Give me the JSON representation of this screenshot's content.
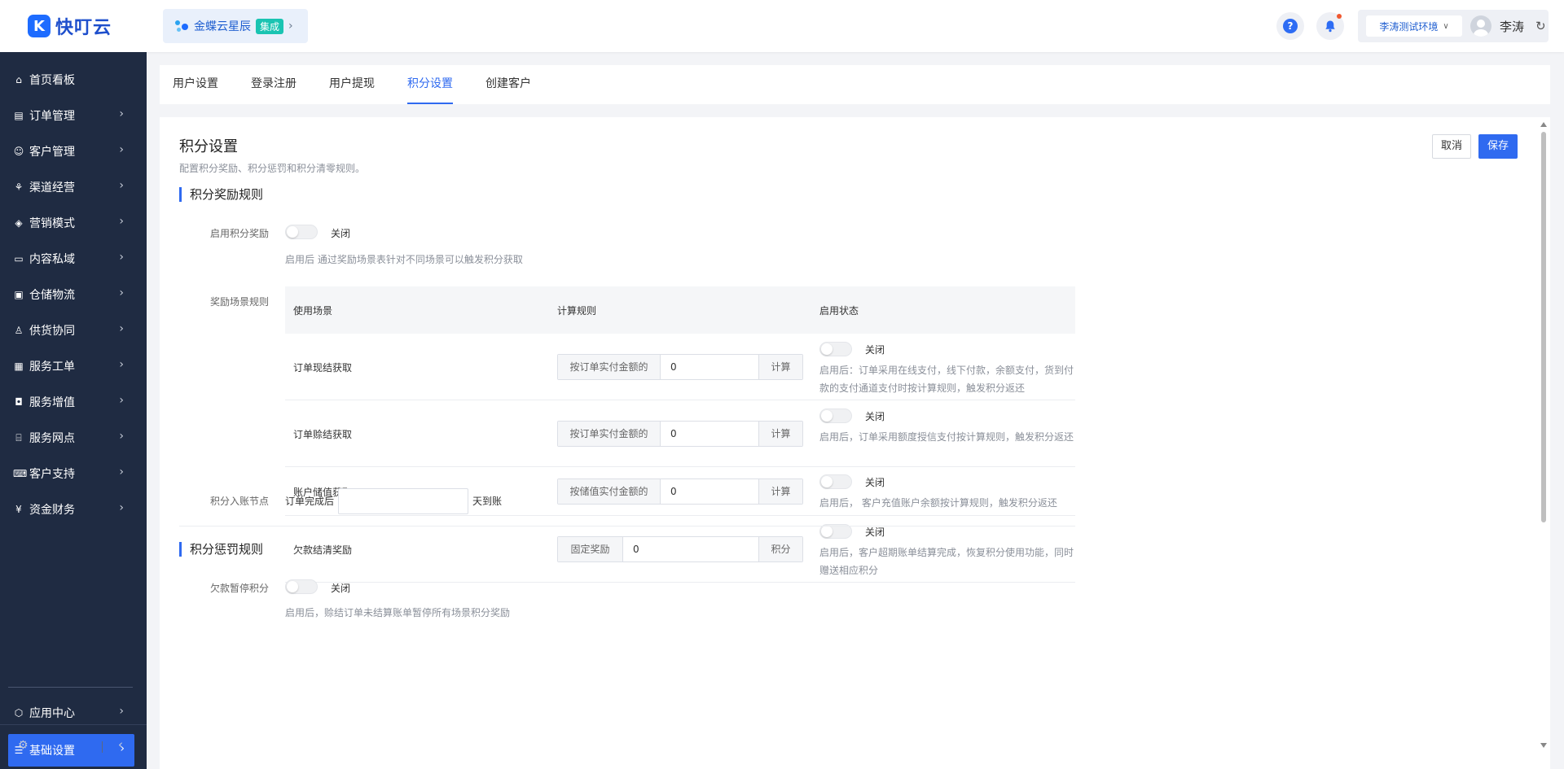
{
  "header": {
    "logo_mark": "K",
    "logo_text": "快叮云",
    "integration_label": "金蝶云星辰",
    "integration_badge": "集成",
    "help_icon": "?",
    "environment": "李涛测试环境",
    "user_name": "李涛"
  },
  "sidebar": {
    "items": [
      {
        "label": "首页看板",
        "icon": "home-icon"
      },
      {
        "label": "订单管理",
        "icon": "clipboard-icon"
      },
      {
        "label": "客户管理",
        "icon": "user-icon"
      },
      {
        "label": "渠道经营",
        "icon": "channel-icon"
      },
      {
        "label": "营销模式",
        "icon": "tag-icon"
      },
      {
        "label": "内容私域",
        "icon": "image-icon"
      },
      {
        "label": "仓储物流",
        "icon": "box-icon"
      },
      {
        "label": "供货协同",
        "icon": "handshake-icon"
      },
      {
        "label": "服务工单",
        "icon": "ticket-icon"
      },
      {
        "label": "服务增值",
        "icon": "bag-icon"
      },
      {
        "label": "服务网点",
        "icon": "store-icon"
      },
      {
        "label": "客户支持",
        "icon": "support-icon"
      },
      {
        "label": "资金财务",
        "icon": "yuan-icon"
      }
    ],
    "bottom_items": [
      {
        "label": "应用中心",
        "icon": "cube-icon"
      },
      {
        "label": "基础设置",
        "icon": "settings-sliders-icon"
      }
    ]
  },
  "tabs": [
    "用户设置",
    "登录注册",
    "用户提现",
    "积分设置",
    "创建客户"
  ],
  "active_tab": "积分设置",
  "page": {
    "title": "积分设置",
    "description": "配置积分奖励、积分惩罚和积分清零规则。",
    "cancel_label": "取消",
    "save_label": "保存"
  },
  "reward": {
    "section_title": "积分奖励规则",
    "enable_label": "启用积分奖励",
    "enable_state": "关闭",
    "enable_hint": "启用后 通过奖励场景表针对不同场景可以触发积分获取",
    "scene_label": "奖励场景规则",
    "columns": [
      "使用场景",
      "计算规则",
      "启用状态"
    ],
    "rows": [
      {
        "scene": "订单现结获取",
        "prefix": "按订单实付金额的",
        "value": "0",
        "suffix": "计算",
        "state": "关闭",
        "desc": "启用后：订单采用在线支付，线下付款，余额支付，货到付款的支付通道支付时按计算规则，触发积分返还"
      },
      {
        "scene": "订单赊结获取",
        "prefix": "按订单实付金额的",
        "value": "0",
        "suffix": "计算",
        "state": "关闭",
        "desc": "启用后，订单采用额度授信支付按计算规则，触发积分返还"
      },
      {
        "scene": "账户储值获取",
        "prefix": "按储值实付金额的",
        "value": "0",
        "suffix": "计算",
        "state": "关闭",
        "desc": "启用后， 客户充值账户余额按计算规则，触发积分返还"
      },
      {
        "scene": "欠款结清奖励",
        "prefix": "固定奖励",
        "value": "0",
        "suffix": "积分",
        "state": "关闭",
        "desc": "启用后，客户超期账单结算完成，恢复积分使用功能，同时赠送相应积分"
      }
    ],
    "node_label": "积分入账节点",
    "node_prefix": "订单完成后",
    "node_value": "",
    "node_suffix": "天到账"
  },
  "penalty": {
    "section_title": "积分惩罚规则",
    "pause_label": "欠款暂停积分",
    "pause_state": "关闭",
    "pause_hint": "启用后，赊结订单未结算账单暂停所有场景积分奖励"
  }
}
